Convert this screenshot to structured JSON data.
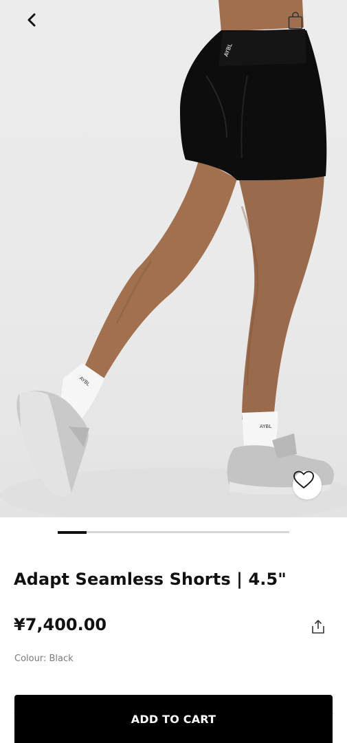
{
  "header": {
    "back_icon": "chevron-left-icon",
    "bag_icon": "shopping-bag-icon"
  },
  "gallery": {
    "image_count": 8,
    "active_index": 0,
    "wishlist_icon": "heart-outline-icon"
  },
  "product": {
    "title": "Adapt Seamless Shorts | 4.5\"",
    "price": "¥7,400.00",
    "colour_label": "Colour: Black",
    "share_icon": "share-icon"
  },
  "actions": {
    "add_to_cart": "ADD TO CART"
  },
  "colors": {
    "cta_background": "#000000",
    "cta_text": "#ffffff",
    "pager_active": "#111111",
    "pager_track": "#d6d6d6",
    "muted_text": "#7a7a7a"
  }
}
